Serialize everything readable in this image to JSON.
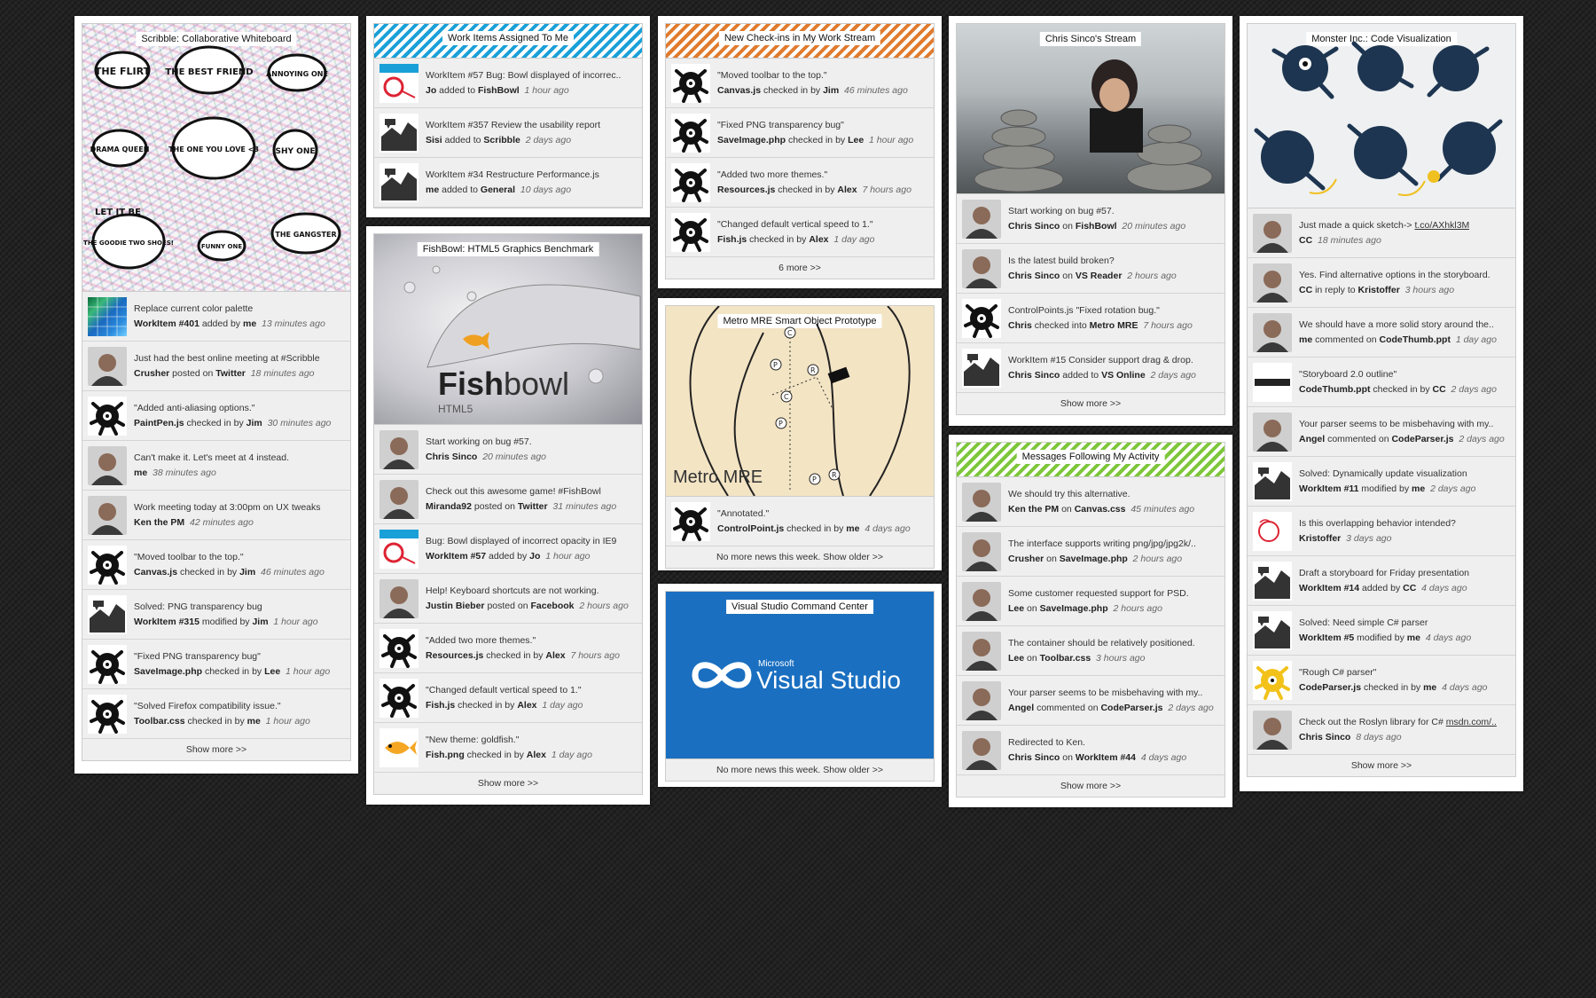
{
  "colors": {
    "background": "#222222",
    "card": "#ffffff",
    "inner": "#efefef",
    "blue_stripe": "#1aa0d8",
    "orange_stripe": "#e07b2e",
    "green_stripe": "#7dc63a",
    "vs_blue": "#1a6fc0"
  },
  "cards": {
    "scribble": {
      "title": "Scribble: Collaborative Whiteboard",
      "bubbles": [
        "THE FLIRT",
        "THE BEST FRIEND",
        "ANNOYING ONE",
        "DRAMA QUEEN",
        "THE ONE YOU LOVE <3",
        "SHY ONE",
        "THE GOODIE TWO SHOES!",
        "FUNNY ONE",
        "THE GANGSTER",
        "LET IT BE"
      ],
      "items": [
        {
          "line1": "Replace current color palette",
          "who": "WorkItem #401",
          "verb": " added by ",
          "target": "me",
          "time": "13 minutes ago",
          "thumb": "palette-icon"
        },
        {
          "line1": "Just had the best online meeting at #Scribble",
          "who": "Crusher",
          "verb": " posted on ",
          "target": "Twitter",
          "time": "18 minutes ago",
          "thumb": "avatar"
        },
        {
          "line1": "\"Added anti-aliasing options.\"",
          "who": "PaintPen.js",
          "verb": " checked in by ",
          "target": "Jim",
          "time": "30 minutes ago",
          "thumb": "bug-icon"
        },
        {
          "line1": "Can't make it. Let's meet at 4 instead.",
          "who": "me",
          "verb": "",
          "target": "",
          "time": "38 minutes ago",
          "thumb": "avatar"
        },
        {
          "line1": "Work meeting today at 3:00pm on UX tweaks",
          "who": "Ken the PM",
          "verb": "",
          "target": "",
          "time": "42 minutes ago",
          "thumb": "avatar"
        },
        {
          "line1": "\"Moved toolbar to the top.\"",
          "who": "Canvas.js",
          "verb": " checked in by ",
          "target": "Jim",
          "time": "46 minutes ago",
          "thumb": "bug-icon"
        },
        {
          "line1": "Solved: PNG transparency bug",
          "who": "WorkItem #315",
          "verb": " modified by ",
          "target": "Jim",
          "time": "1 hour ago",
          "thumb": "chart-icon"
        },
        {
          "line1": "\"Fixed PNG transparency bug\"",
          "who": "SaveImage.php",
          "verb": " checked in by ",
          "target": "Lee",
          "time": "1 hour ago",
          "thumb": "bug-icon"
        },
        {
          "line1": "\"Solved Firefox compatibility issue.\"",
          "who": "Toolbar.css",
          "verb": " checked in by ",
          "target": "me",
          "time": "1 hour ago",
          "thumb": "bug-icon"
        }
      ],
      "more": "Show more >>"
    },
    "workitems": {
      "title": "Work Items Assigned To Me",
      "items": [
        {
          "line1": "WorkItem #57 Bug: Bowl displayed of incorrec..",
          "who": "Jo",
          "verb": " added to ",
          "target": "FishBowl",
          "time": "1 hour ago",
          "thumb": "bug-report-icon"
        },
        {
          "line1": "WorkItem #357 Review the usability report",
          "who": "Sisi",
          "verb": " added to ",
          "target": "Scribble",
          "time": "2 days ago",
          "thumb": "chart-icon"
        },
        {
          "line1": "WorkItem #34 Restructure Performance.js",
          "who": "me",
          "verb": " added to ",
          "target": "General",
          "time": "10 days ago",
          "thumb": "chart-icon"
        }
      ]
    },
    "fishbowl": {
      "title": "FishBowl: HTML5 Graphics Benchmark",
      "logo_bold": "Fish",
      "logo_light": "bowl",
      "logo_sub": "HTML5",
      "items": [
        {
          "line1": "Start working on bug #57.",
          "who": "Chris Sinco",
          "verb": "",
          "target": "",
          "time": "20 minutes ago",
          "thumb": "avatar"
        },
        {
          "line1": "Check out this awesome game! #FishBowl",
          "who": "Miranda92",
          "verb": " posted on ",
          "target": "Twitter",
          "time": "31 minutes ago",
          "thumb": "avatar"
        },
        {
          "line1": "Bug: Bowl displayed of incorrect opacity in IE9",
          "who": "WorkItem #57",
          "verb": " added by ",
          "target": "Jo",
          "time": "1 hour ago",
          "thumb": "bug-report-icon"
        },
        {
          "line1": "Help! Keyboard shortcuts are not working.",
          "who": "Justin Bieber",
          "verb": " posted on ",
          "target": "Facebook",
          "time": "2 hours ago",
          "thumb": "avatar"
        },
        {
          "line1": "\"Added two more themes.\"",
          "who": "Resources.js",
          "verb": " checked in by ",
          "target": "Alex",
          "time": "7 hours ago",
          "thumb": "bug-icon"
        },
        {
          "line1": "\"Changed default vertical speed to 1.\"",
          "who": "Fish.js",
          "verb": " checked in by ",
          "target": "Alex",
          "time": "1 day ago",
          "thumb": "bug-icon"
        },
        {
          "line1": "\"New theme: goldfish.\"",
          "who": "Fish.png",
          "verb": " checked in by ",
          "target": "Alex",
          "time": "1 day ago",
          "thumb": "goldfish-icon"
        }
      ],
      "more": "Show more >>"
    },
    "checkins": {
      "title": "New Check-ins in My Work Stream",
      "items": [
        {
          "line1": "\"Moved toolbar to the top.\"",
          "who": "Canvas.js",
          "verb": " checked in by ",
          "target": "Jim",
          "time": "46 minutes ago",
          "thumb": "bug-icon"
        },
        {
          "line1": "\"Fixed PNG transparency bug\"",
          "who": "SaveImage.php",
          "verb": " checked in by ",
          "target": "Lee",
          "time": "1 hour ago",
          "thumb": "bug-icon"
        },
        {
          "line1": "\"Added two more themes.\"",
          "who": "Resources.js",
          "verb": " checked in by ",
          "target": "Alex",
          "time": "7 hours ago",
          "thumb": "bug-icon"
        },
        {
          "line1": "\"Changed default vertical speed to 1.\"",
          "who": "Fish.js",
          "verb": " checked in by ",
          "target": "Alex",
          "time": "1 day ago",
          "thumb": "bug-icon"
        }
      ],
      "more": "6 more >>"
    },
    "metro": {
      "title": "Metro MRE Smart Object Prototype",
      "label": "Metro MRE",
      "items": [
        {
          "line1": "\"Annotated.\"",
          "who": "ControlPoint.js",
          "verb": " checked in by ",
          "target": "me",
          "time": "4 days ago",
          "thumb": "bug-icon"
        }
      ],
      "more": "No more news this week. Show older >>"
    },
    "vs": {
      "title": "Visual Studio Command Center",
      "brand_small": "Microsoft",
      "brand_big": "Visual Studio",
      "more": "No more news this week. Show older >>"
    },
    "chris": {
      "title": "Chris Sinco's Stream",
      "items": [
        {
          "line1": "Start working on bug #57.",
          "who": "Chris Sinco",
          "verb": " on ",
          "target": "FishBowl",
          "time": "20 minutes ago",
          "thumb": "avatar"
        },
        {
          "line1": "Is the latest build broken?",
          "who": "Chris Sinco",
          "verb": " on ",
          "target": "VS Reader",
          "time": "2 hours ago",
          "thumb": "avatar"
        },
        {
          "line1": "ControlPoints.js \"Fixed rotation bug.\"",
          "who": "Chris",
          "verb": " checked into ",
          "target": "Metro MRE",
          "time": "7 hours ago",
          "thumb": "bug-icon"
        },
        {
          "line1": "WorkItem #15 Consider support drag & drop.",
          "who": "Chris Sinco",
          "verb": " added to ",
          "target": "VS Online",
          "time": "2 days ago",
          "thumb": "chart-icon"
        }
      ],
      "more": "Show more >>"
    },
    "messages": {
      "title": "Messages Following My Activity",
      "items": [
        {
          "line1": "We should try this alternative.",
          "who": "Ken the PM",
          "verb": " on ",
          "target": "Canvas.css",
          "time": "45 minutes ago",
          "thumb": "avatar"
        },
        {
          "line1": "The interface supports writing png/jpg/jpg2k/..",
          "who": "Crusher",
          "verb": " on ",
          "target": "SaveImage.php",
          "time": "2 hours ago",
          "thumb": "avatar"
        },
        {
          "line1": "Some customer requested support for PSD.",
          "who": "Lee",
          "verb": " on ",
          "target": "SaveImage.php",
          "time": "2 hours ago",
          "thumb": "avatar"
        },
        {
          "line1": "The container should be relatively positioned.",
          "who": "Lee",
          "verb": " on ",
          "target": "Toolbar.css",
          "time": "3 hours ago",
          "thumb": "avatar"
        },
        {
          "line1": "Your parser seems to be misbehaving with my..",
          "who": "Angel",
          "verb": " commented on ",
          "target": "CodeParser.js",
          "time": "2 days ago",
          "thumb": "avatar"
        },
        {
          "line1": "Redirected to Ken.",
          "who": "Chris Sinco",
          "verb": " on ",
          "target": "WorkItem #44",
          "time": "4 days ago",
          "thumb": "avatar"
        }
      ],
      "more": "Show more >>"
    },
    "monster": {
      "title": "Monster Inc.: Code Visualization",
      "items": [
        {
          "line1": "Just made a quick sketch-> ",
          "link": "t.co/AXhkl3M",
          "who": "CC",
          "verb": "",
          "target": "",
          "time": "18 minutes ago",
          "thumb": "avatar"
        },
        {
          "line1": "Yes. Find alternative options in the storyboard.",
          "who": "CC",
          "verb": " in reply to ",
          "target": "Kristoffer",
          "time": "3 hours ago",
          "thumb": "avatar"
        },
        {
          "line1": "We should have a more solid story around the..",
          "who": "me",
          "verb": " commented on ",
          "target": "CodeThumb.ppt",
          "time": "1 day ago",
          "thumb": "avatar"
        },
        {
          "line1": "\"Storyboard 2.0 outline\"",
          "who": "CodeThumb.ppt",
          "verb": " checked in by ",
          "target": "CC",
          "time": "2 days ago",
          "thumb": "monsters-logo"
        },
        {
          "line1": "Your parser seems to be misbehaving with my..",
          "who": "Angel",
          "verb": " commented on ",
          "target": "CodeParser.js",
          "time": "2 days ago",
          "thumb": "avatar"
        },
        {
          "line1": "Solved: Dynamically update visualization",
          "who": "WorkItem #11",
          "verb": " modified by ",
          "target": "me",
          "time": "2 days ago",
          "thumb": "chart-icon"
        },
        {
          "line1": "Is this overlapping behavior intended?",
          "who": "Kristoffer",
          "verb": "",
          "target": "",
          "time": "3 days ago",
          "thumb": "sketch-icon"
        },
        {
          "line1": "Draft a storyboard for Friday presentation",
          "who": "WorkItem #14",
          "verb": " added by ",
          "target": "CC",
          "time": "4 days ago",
          "thumb": "chart-icon"
        },
        {
          "line1": "Solved: Need simple C# parser",
          "who": "WorkItem #5",
          "verb": " modified by ",
          "target": "me",
          "time": "4 days ago",
          "thumb": "chart-icon"
        },
        {
          "line1": "\"Rough C# parser\"",
          "who": "CodeParser.js",
          "verb": " checked in by ",
          "target": "me",
          "time": "4 days ago",
          "thumb": "sun-bug-icon"
        },
        {
          "line1": "Check out the Roslyn library for C# ",
          "link": "msdn.com/..",
          "who": "Chris Sinco",
          "verb": "",
          "target": "",
          "time": "8 days ago",
          "thumb": "avatar"
        }
      ],
      "more": "Show more >>"
    }
  }
}
